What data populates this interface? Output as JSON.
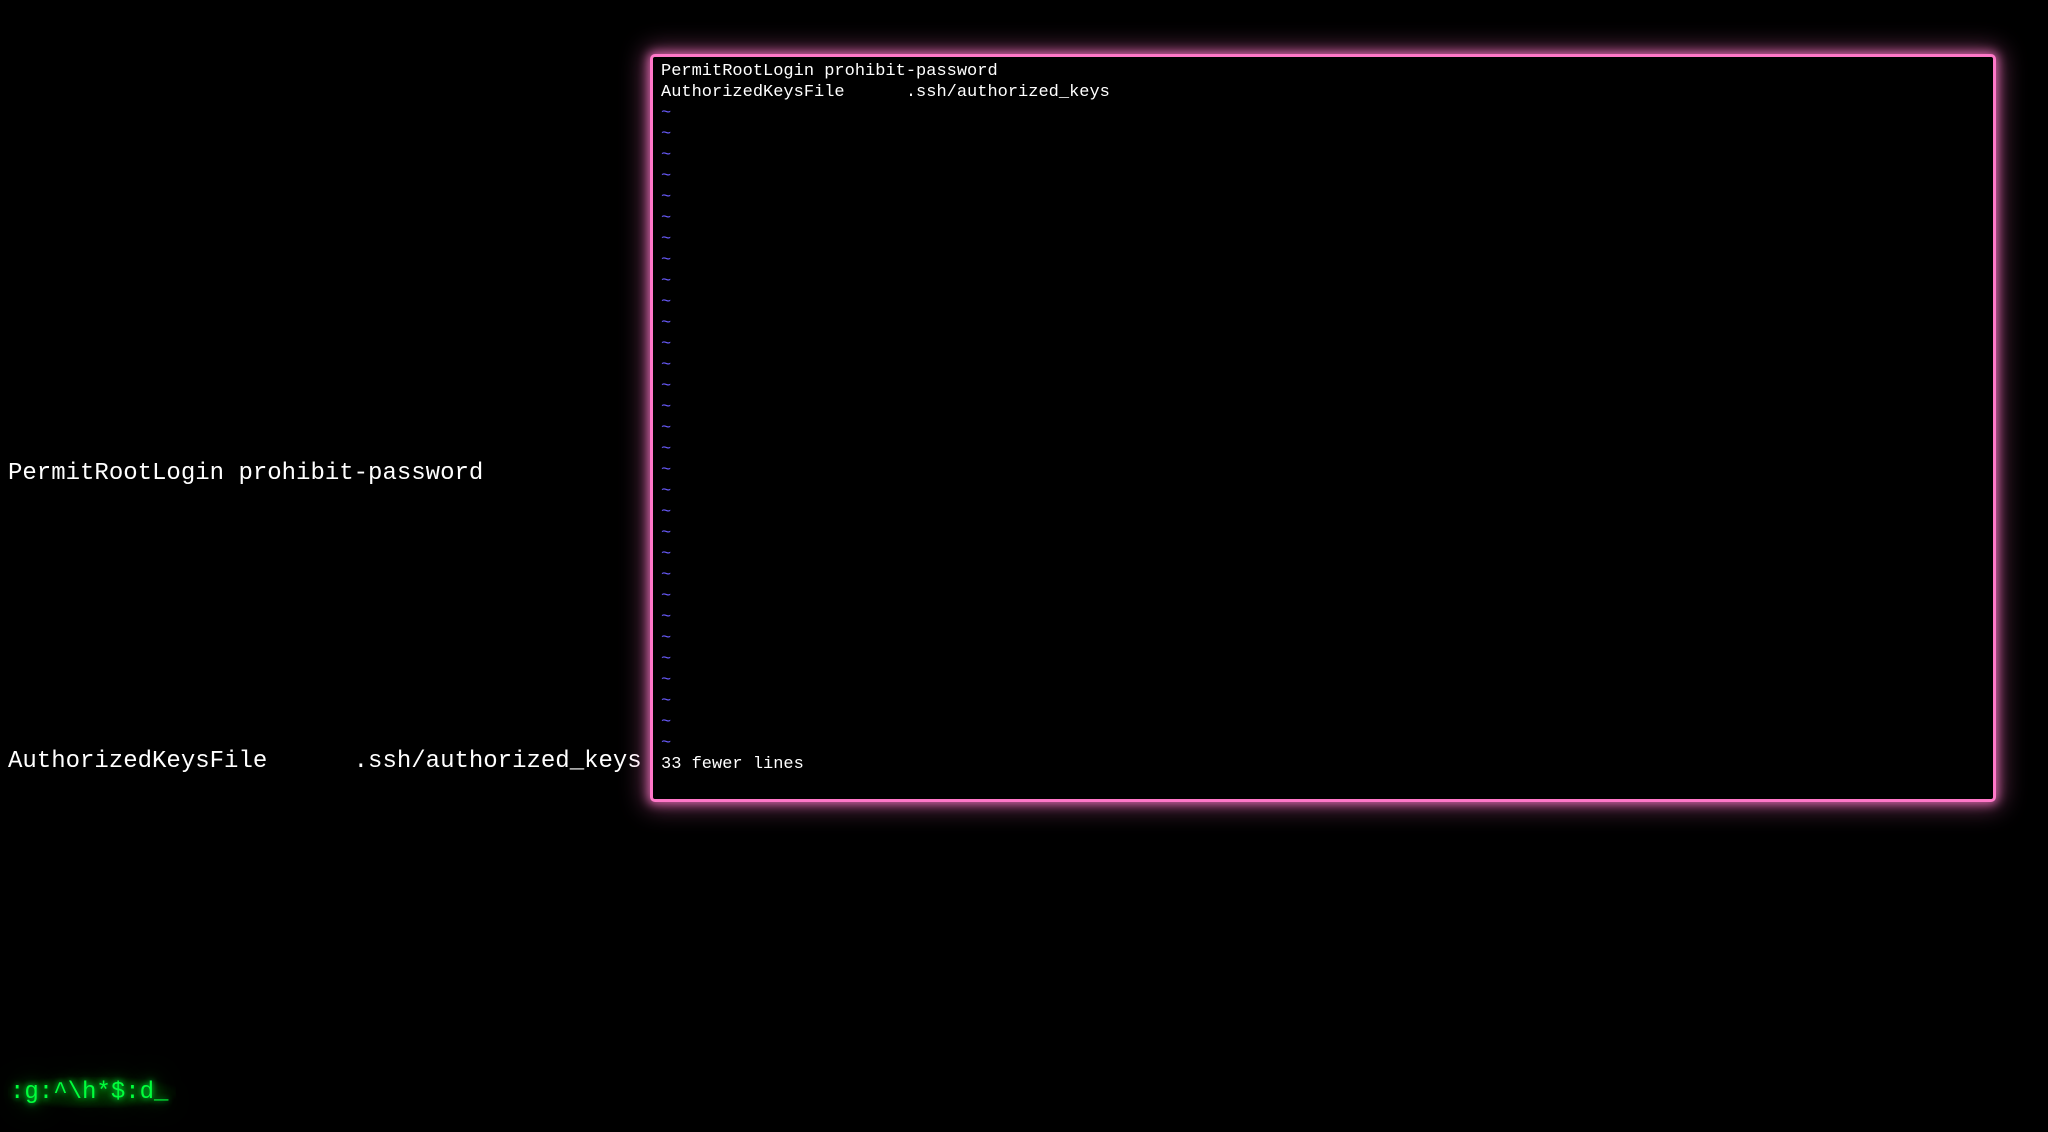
{
  "left_text": {
    "line1": "PermitRootLogin prohibit-password",
    "line2": "AuthorizedKeysFile      .ssh/authorized_keys"
  },
  "command_line": ":g:^\\h*$:d_",
  "vim": {
    "content_lines": [
      "PermitRootLogin prohibit-password",
      "AuthorizedKeysFile      .ssh/authorized_keys"
    ],
    "tilde_char": "~",
    "tilde_count": 31,
    "status_line": "33 fewer lines"
  },
  "colors": {
    "background": "#000000",
    "text": "#ffffff",
    "tilde": "#6a5cff",
    "command": "#00ff3c",
    "border": "#ff77c8"
  }
}
